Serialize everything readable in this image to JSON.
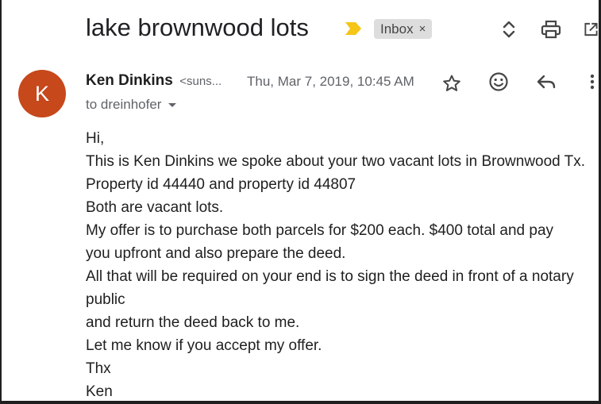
{
  "header": {
    "subject": "lake brownwood lots",
    "label": "Inbox",
    "label_remove": "×"
  },
  "sender": {
    "avatar_letter": "K",
    "name": "Ken Dinkins",
    "email": "<suns...",
    "date": "Thu, Mar 7, 2019, 10:45 AM",
    "recipient": "to dreinhofer"
  },
  "body": {
    "lines": [
      "Hi,",
      "This is Ken Dinkins we spoke about your two vacant lots in Brownwood Tx.",
      "Property id  44440 and property id  44807",
      "Both are vacant lots.",
      "My offer is to purchase both parcels for $200 each. $400 total and pay",
      "you upfront and also prepare the deed.",
      "All that will be required on your end is to sign the deed in front of a notary",
      "public",
      "and return the deed back to me.",
      "Let me know if you accept my offer.",
      "Thx",
      "Ken"
    ]
  },
  "colors": {
    "avatar": "#c6481b",
    "importance": "#f5c518",
    "label_chip": "#dddddd"
  },
  "icons": {
    "importance": "importance-marker-icon",
    "expand": "expand-collapse-icon",
    "print": "print-icon",
    "open_new": "open-in-new-window-icon",
    "star": "star-icon",
    "emoji": "emoji-reaction-icon",
    "reply": "reply-icon",
    "more": "more-options-icon"
  }
}
